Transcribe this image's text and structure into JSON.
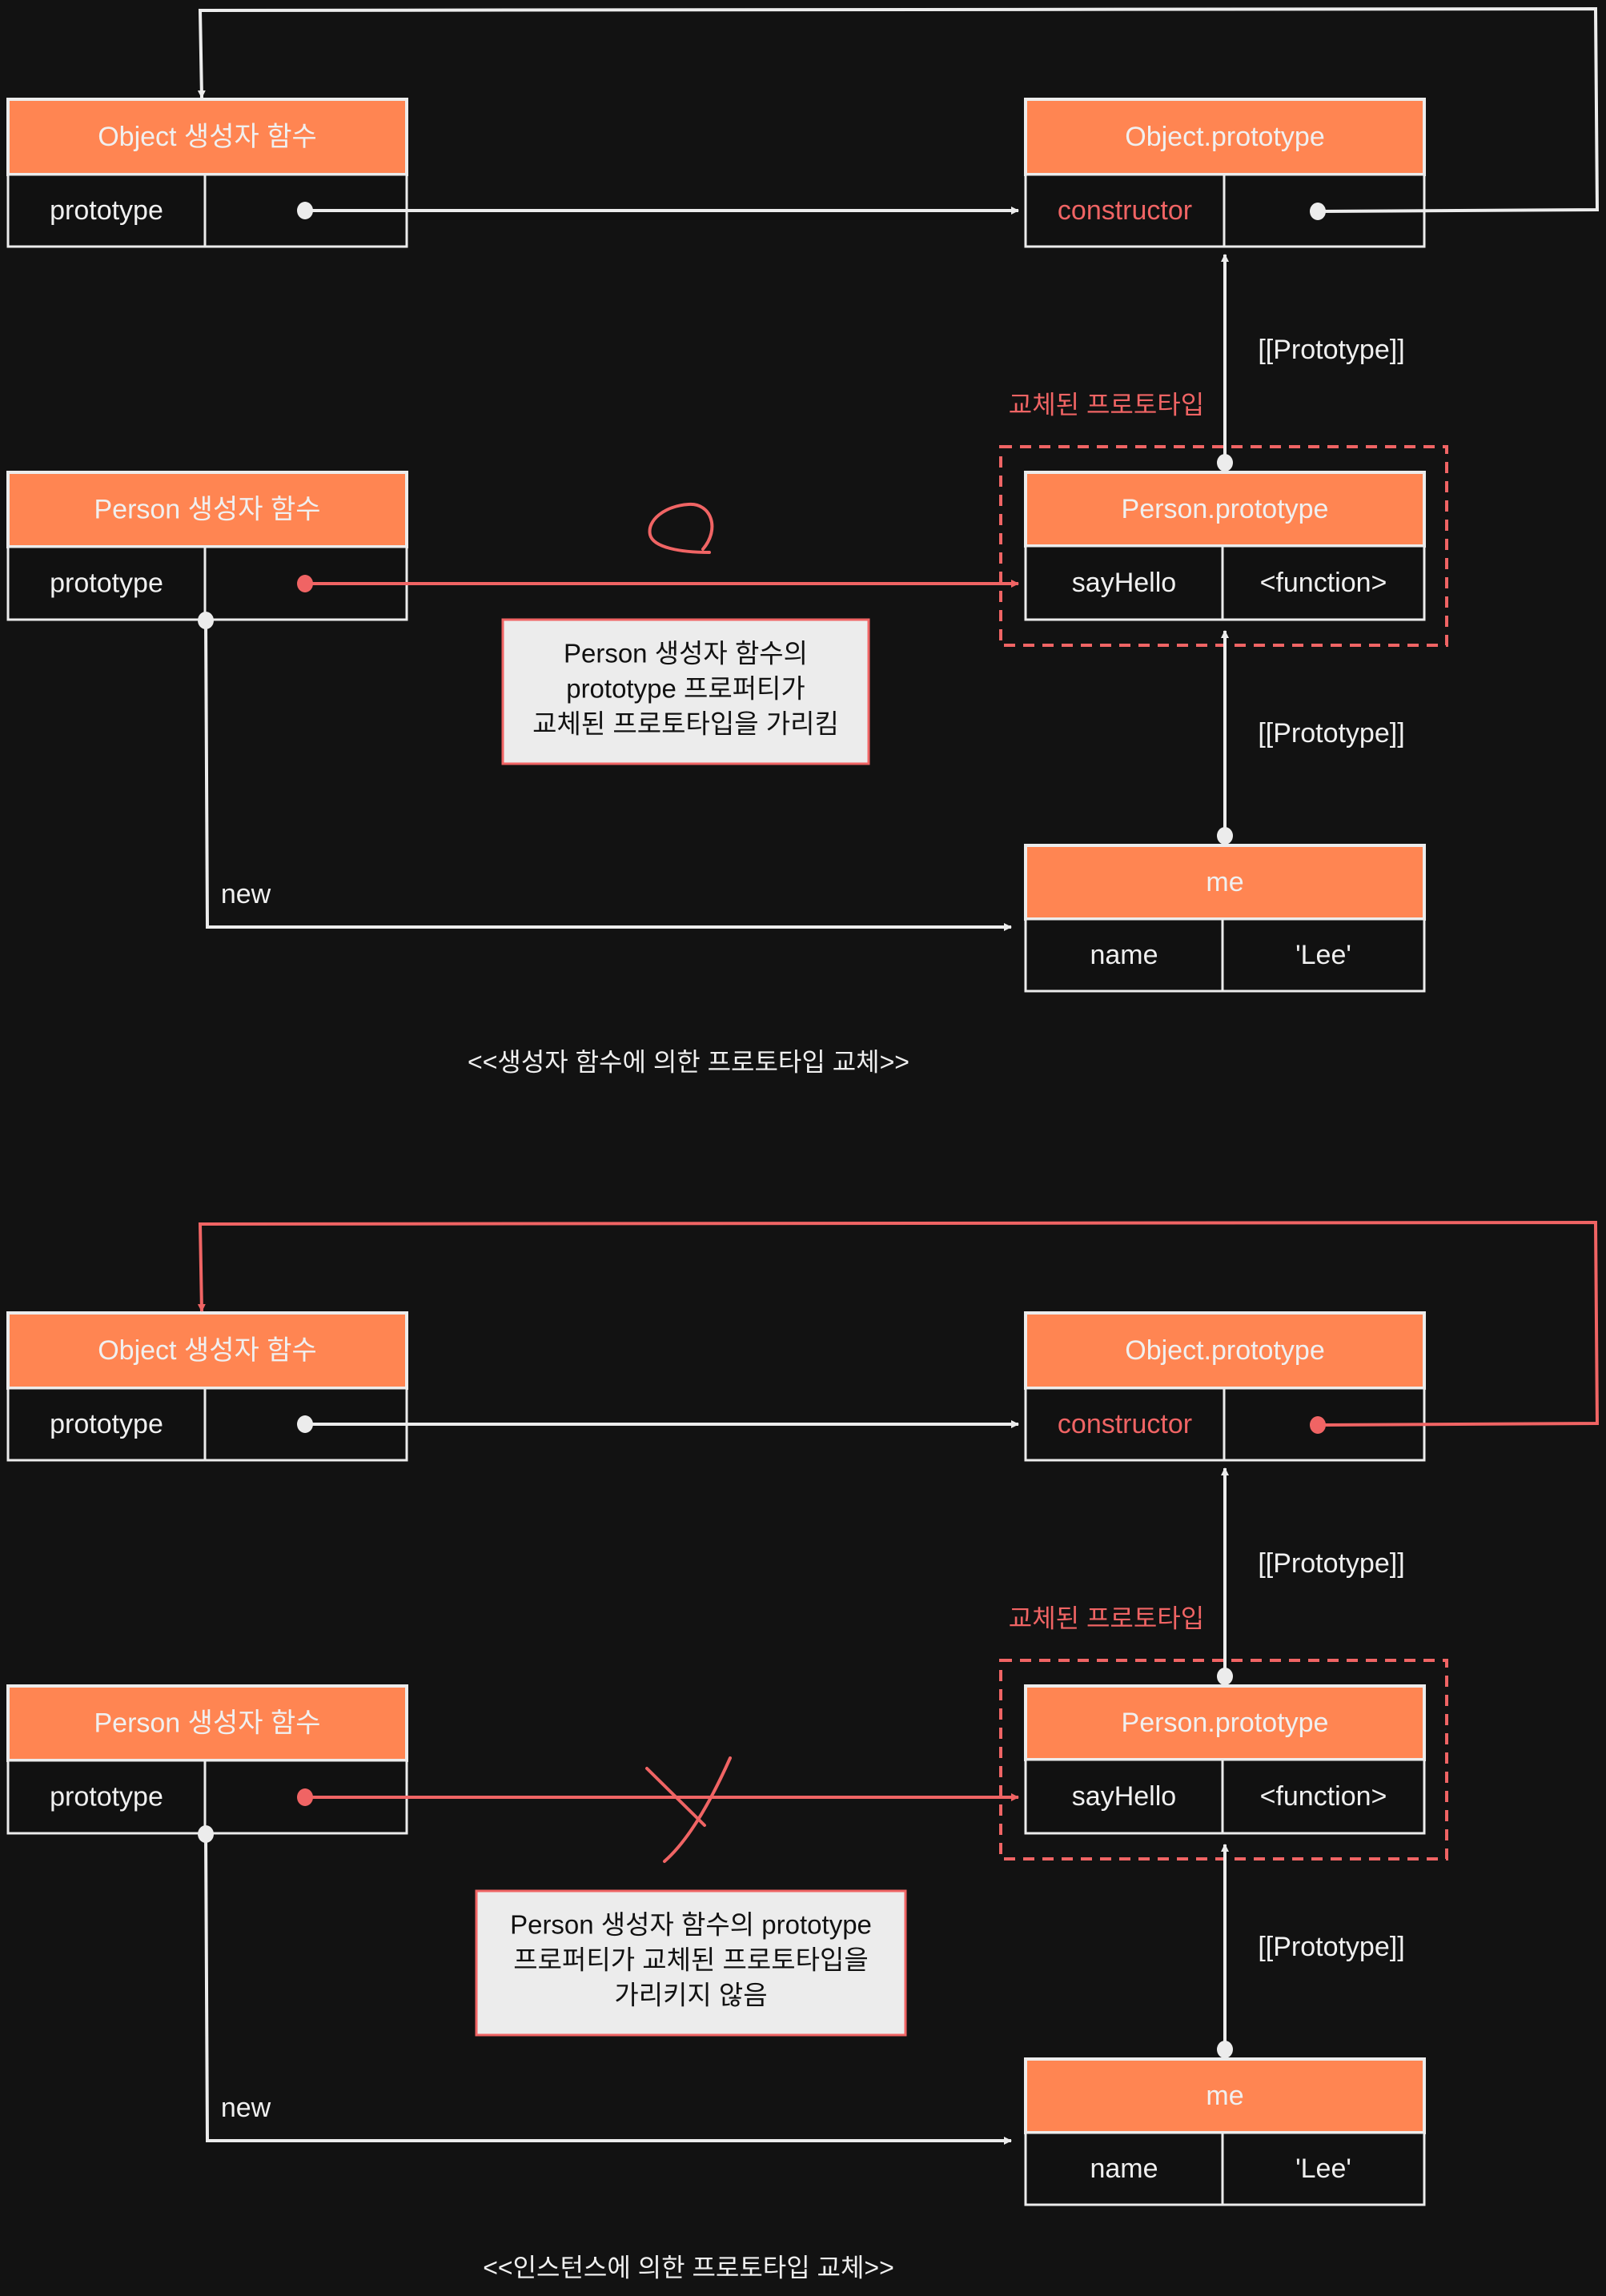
{
  "colors": {
    "background": "#121212",
    "header": "#ff8552",
    "stroke": "#ececec",
    "accent_red": "#f06464",
    "callout_bg": "#ececec",
    "text_light": "#f0f0f0",
    "text_dark": "#111111"
  },
  "sections": [
    {
      "id": "constructor-replacement",
      "caption": "<<생성자 함수에 의한 프로토타입 교체>>",
      "object_constructor": {
        "title": "Object 생성자 함수",
        "key": "prototype"
      },
      "object_prototype": {
        "title": "Object.prototype",
        "key": "constructor"
      },
      "person_constructor": {
        "title": "Person 생성자 함수",
        "key": "prototype"
      },
      "person_prototype": {
        "title": "Person.prototype",
        "key": "sayHello",
        "value": "<function>"
      },
      "replaced_label": "교체된 프로토타입",
      "prototype_link_upper": "[[Prototype]]",
      "prototype_link_lower": "[[Prototype]]",
      "instance": {
        "title": "me",
        "key": "name",
        "value": "'Lee'"
      },
      "new_label": "new",
      "callout": [
        "Person 생성자 함수의",
        "prototype 프로퍼티가",
        "교체된 프로토타입을 가리킴"
      ],
      "link_status": "ok",
      "loop_color": "stroke"
    },
    {
      "id": "instance-replacement",
      "caption": "<<인스턴스에 의한 프로토타입 교체>>",
      "object_constructor": {
        "title": "Object 생성자 함수",
        "key": "prototype"
      },
      "object_prototype": {
        "title": "Object.prototype",
        "key": "constructor"
      },
      "person_constructor": {
        "title": "Person 생성자 함수",
        "key": "prototype"
      },
      "person_prototype": {
        "title": "Person.prototype",
        "key": "sayHello",
        "value": "<function>"
      },
      "replaced_label": "교체된 프로토타입",
      "prototype_link_upper": "[[Prototype]]",
      "prototype_link_lower": "[[Prototype]]",
      "instance": {
        "title": "me",
        "key": "name",
        "value": "'Lee'"
      },
      "new_label": "new",
      "callout": [
        "Person 생성자 함수의 prototype",
        "프로퍼티가 교체된 프로토타입을",
        "가리키지 않음"
      ],
      "link_status": "broken",
      "loop_color": "accent_red"
    }
  ]
}
